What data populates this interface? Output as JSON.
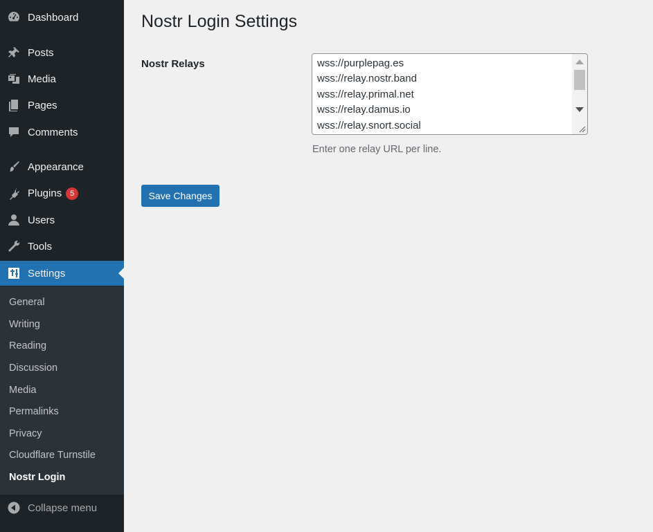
{
  "sidebar": {
    "items": [
      {
        "label": "Dashboard",
        "icon": "dashboard-icon"
      },
      {
        "label": "Posts",
        "icon": "pin-icon"
      },
      {
        "label": "Media",
        "icon": "media-icon"
      },
      {
        "label": "Pages",
        "icon": "pages-icon"
      },
      {
        "label": "Comments",
        "icon": "comment-icon"
      },
      {
        "label": "Appearance",
        "icon": "paintbrush-icon"
      },
      {
        "label": "Plugins",
        "icon": "plugin-icon",
        "badge": "5"
      },
      {
        "label": "Users",
        "icon": "user-icon"
      },
      {
        "label": "Tools",
        "icon": "wrench-icon"
      },
      {
        "label": "Settings",
        "icon": "settings-icon",
        "active": true
      }
    ],
    "submenu": [
      {
        "label": "General"
      },
      {
        "label": "Writing"
      },
      {
        "label": "Reading"
      },
      {
        "label": "Discussion"
      },
      {
        "label": "Media"
      },
      {
        "label": "Permalinks"
      },
      {
        "label": "Privacy"
      },
      {
        "label": "Cloudflare Turnstile"
      },
      {
        "label": "Nostr Login",
        "current": true
      }
    ],
    "collapse_label": "Collapse menu"
  },
  "main": {
    "title": "Nostr Login Settings",
    "field_label": "Nostr Relays",
    "relays": [
      "wss://purplepag.es",
      "wss://relay.nostr.band",
      "wss://relay.primal.net",
      "wss://relay.damus.io",
      "wss://relay.snort.social"
    ],
    "description": "Enter one relay URL per line.",
    "save_label": "Save Changes"
  },
  "colors": {
    "sidebar_bg": "#1d2327",
    "submenu_bg": "#2c3338",
    "accent": "#2271b1",
    "badge": "#d63638",
    "page_bg": "#f0f0f1"
  }
}
